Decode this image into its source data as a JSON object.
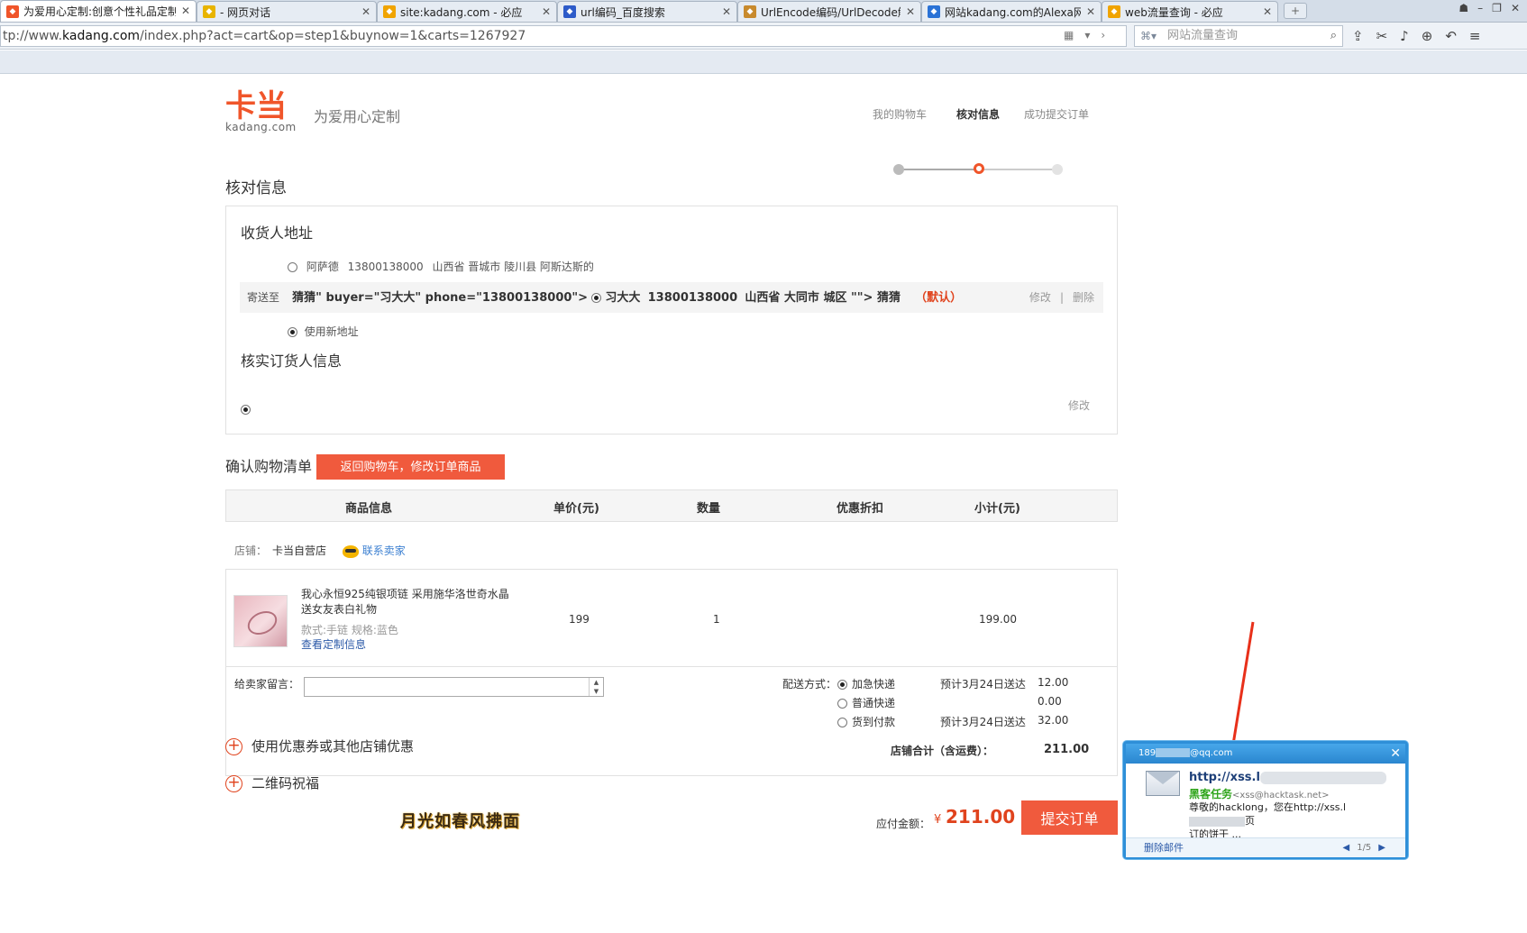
{
  "browser": {
    "tabs": [
      {
        "title": "为爱用心定制:创意个性礼品定制",
        "icon": "kadang-logo-icon",
        "color": "#f0552a",
        "active": true
      },
      {
        "title": "- 网页对话",
        "icon": "smiley-icon",
        "color": "#e8b400"
      },
      {
        "title": "site:kadang.com - 必应",
        "icon": "bing-icon",
        "color": "#f0a400"
      },
      {
        "title": "url编码_百度搜索",
        "icon": "baidu-paw-icon",
        "color": "#2d5bc9"
      },
      {
        "title": "UrlEncode编码/UrlDecode解",
        "icon": "page-icon",
        "color": "#c88a2d"
      },
      {
        "title": "网站kadang.com的Alexa网站",
        "icon": "alexa-icon",
        "color": "#2a72d6"
      },
      {
        "title": "web流量查询 - 必应",
        "icon": "bing-icon",
        "color": "#f0a400"
      }
    ],
    "new_tab": "+",
    "url_prefix": "tp://www.",
    "url_domain": "kadang.com",
    "url_rest": "/index.php?act=cart&op=step1&buynow=1&carts=1267927",
    "search_placeholder": "网站流量查询"
  },
  "header": {
    "logo_text": "卡当",
    "logo_domain": "kadang.com",
    "slogan": "为爱用心定制",
    "steps": [
      "我的购物车",
      "核对信息",
      "成功提交订单"
    ],
    "current_step": 1
  },
  "verify": {
    "title": "核对信息",
    "address_section": "收货人地址",
    "addresses": [
      {
        "name": "阿萨德",
        "phone": "13800138000",
        "region": "山西省 晋城市 陵川县 阿斯达斯的"
      }
    ],
    "selected": {
      "prefix": "寄送至",
      "injected": "猜猜\" buyer=\"习大大\" phone=\"13800138000\">",
      "name": "习大大",
      "phone": "13800138000",
      "region": "山西省 大同市 城区 \"\"> 猜猜",
      "default_tag": "（默认）",
      "edit": "修改",
      "sep": "|",
      "delete": "删除"
    },
    "new_address": "使用新地址",
    "buyer_section": "核实订货人信息",
    "buyer_edit": "修改"
  },
  "cart": {
    "title": "确认购物清单",
    "back_button": "返回购物车，修改订单商品",
    "columns": [
      "商品信息",
      "单价(元)",
      "数量",
      "优惠折扣",
      "小计(元)"
    ],
    "store_label": "店铺：",
    "store_name": "卡当自营店",
    "contact": "联系卖家",
    "item": {
      "name": "我心永恒925纯银项链 采用施华洛世奇水晶 送女友表白礼物",
      "spec": "款式:手链 规格:蓝色",
      "custom_link": "查看定制信息",
      "price": "199",
      "qty": "1",
      "subtotal": "199.00"
    },
    "message_label": "给卖家留言：",
    "message_value": "",
    "shipping_label": "配送方式：",
    "shipping": [
      {
        "name": "加急快递",
        "eta": "预计3月24日送达",
        "price": "12.00",
        "selected": true
      },
      {
        "name": "普通快递",
        "eta": "",
        "price": "0.00",
        "selected": false
      },
      {
        "name": "货到付款",
        "eta": "预计3月24日送达",
        "price": "32.00",
        "selected": false
      }
    ],
    "store_total_label": "店铺合计（含运费）：",
    "store_total": "211.00"
  },
  "options": {
    "coupon": "使用优惠券或其他店铺优惠",
    "qrcode": "二维码祝福"
  },
  "footer": {
    "watermark": "月光如春风拂面",
    "pay_label": "应付金额：",
    "currency": "¥",
    "amount": "211.00",
    "submit": "提交订单"
  },
  "popup": {
    "account_prefix": "189",
    "account_suffix": "@qq.com",
    "subject": "http://xss.l",
    "from_name": "黑客任务",
    "from_addr": "<xss@hacktask.net>",
    "body_a": "尊敬的hacklong，您在http://xss.l",
    "body_b": "页",
    "body_c": "订的饼干 ...",
    "delete": "删除邮件",
    "page": "1/5"
  }
}
